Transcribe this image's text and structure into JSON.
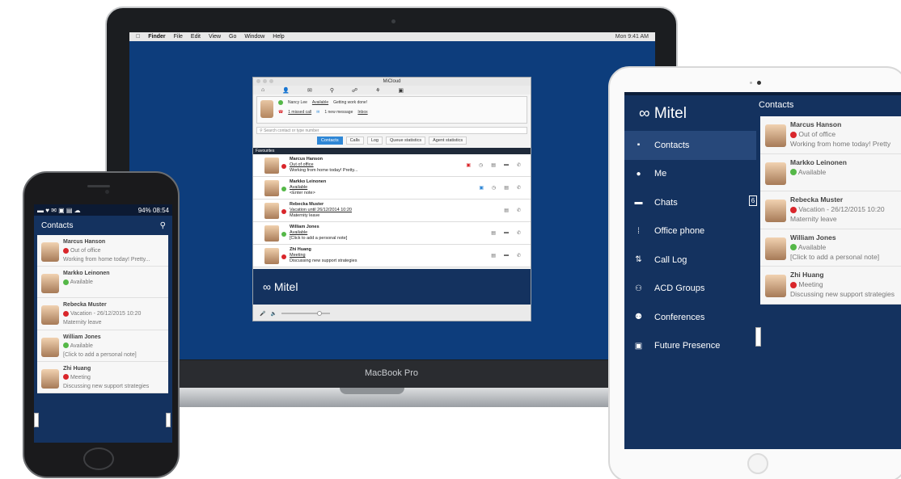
{
  "laptop": {
    "brand": "MacBook Pro",
    "menubar": {
      "apple": "",
      "items": [
        "Finder",
        "File",
        "Edit",
        "View",
        "Go",
        "Window",
        "Help"
      ],
      "clock": "Mon 9:41 AM"
    }
  },
  "desktop_app": {
    "window_title": "MiCloud",
    "user": {
      "name": "Nancy Lee",
      "status": "Available",
      "note": "Getting work done!",
      "missed_calls": "1 missed call",
      "messages": "1 new message",
      "inbox_link": "Inbox"
    },
    "search_placeholder": "Search contact or type number",
    "tabs": [
      "Contacts",
      "Calls",
      "Log",
      "Queue statistics",
      "Agent statistics"
    ],
    "section": "Favourites",
    "contacts": [
      {
        "name": "Marcus Hanson",
        "status": "Out of office",
        "note": "Working from home today! Pretty..."
      },
      {
        "name": "Markko Leinonen",
        "status": "Available",
        "note": "<Enter note>"
      },
      {
        "name": "Rebecka Muster",
        "status": "Vacation until 26/12/2014 10:20",
        "note": "Maternity leave"
      },
      {
        "name": "William Jones",
        "status": "Available",
        "note": "[Click to add a personal note]"
      },
      {
        "name": "Zhi Huang",
        "status": "Meeting",
        "note": "Discussing new support strategies"
      }
    ],
    "logo": "Mitel"
  },
  "tablet": {
    "logo": "Mitel",
    "header": "Contacts",
    "chats_badge": "6",
    "nav": [
      {
        "label": "Contacts",
        "icon": "contact-card-icon"
      },
      {
        "label": "Me",
        "icon": "person-icon"
      },
      {
        "label": "Chats",
        "icon": "chat-icon"
      },
      {
        "label": "Office phone",
        "icon": "dialpad-icon"
      },
      {
        "label": "Call Log",
        "icon": "call-log-icon"
      },
      {
        "label": "ACD Groups",
        "icon": "groups-icon"
      },
      {
        "label": "Conferences",
        "icon": "conference-icon"
      },
      {
        "label": "Future Presence",
        "icon": "calendar-icon"
      }
    ],
    "contacts": [
      {
        "name": "Marcus Hanson",
        "status": "Out of office",
        "note": "Working from home today! Pretty"
      },
      {
        "name": "Markko Leinonen",
        "status": "Available",
        "note": ""
      },
      {
        "name": "Rebecka Muster",
        "status": "Vacation - 26/12/2015 10:20",
        "note": "Maternity leave"
      },
      {
        "name": "William Jones",
        "status": "Available",
        "note": "[Click to add a personal note]"
      },
      {
        "name": "Zhi Huang",
        "status": "Meeting",
        "note": "Discussing new support strategies"
      }
    ]
  },
  "phone": {
    "status_left": "▬ ♥ ✉ ▣ ▤ ☁",
    "status_right": "94% 08:54",
    "header": "Contacts",
    "contacts": [
      {
        "name": "Marcus Hanson",
        "status": "Out of office",
        "note": "Working from home today! Pretty..."
      },
      {
        "name": "Markko Leinonen",
        "status": "Available",
        "note": ""
      },
      {
        "name": "Rebecka Muster",
        "status": "Vacation - 26/12/2015 10:20",
        "note": "Maternity leave"
      },
      {
        "name": "William Jones",
        "status": "Available",
        "note": "[Click to add a personal note]"
      },
      {
        "name": "Zhi Huang",
        "status": "Meeting",
        "note": "Discussing new support strategies"
      }
    ]
  },
  "colors": {
    "brand_navy": "#14325f",
    "available": "#55b848",
    "busy": "#d9262b",
    "accent_blue": "#2f87d6"
  }
}
